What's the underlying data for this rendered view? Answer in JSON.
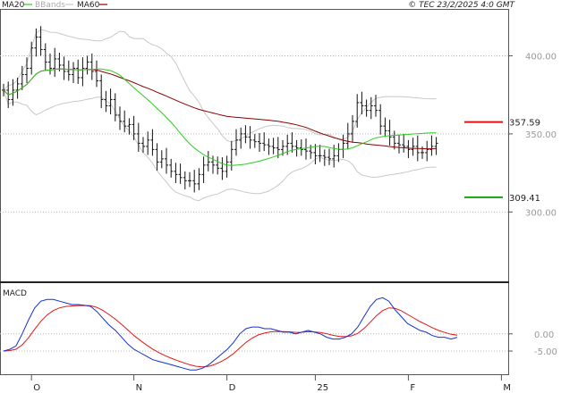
{
  "header": {
    "legend": [
      {
        "label": "MA20",
        "color": "#2ecc1f"
      },
      {
        "label": "BBands",
        "color": "#c8c8c8"
      },
      {
        "label": "MA60",
        "color": "#8b0000"
      }
    ],
    "copyright": "© TEC 23/2/2025 4:0 GMT"
  },
  "chart_data": [
    {
      "type": "line",
      "title": "",
      "ylim": [
        255,
        430
      ],
      "y_ticks": [
        {
          "label": "400.00",
          "value": 400
        },
        {
          "label": "350.00",
          "value": 350
        },
        {
          "label": "300.00",
          "value": 300
        }
      ],
      "x_ticks": [
        {
          "label": "O",
          "index": 6
        },
        {
          "label": "N",
          "index": 28
        },
        {
          "label": "D",
          "index": 48
        },
        {
          "label": "25",
          "index": 67
        },
        {
          "label": "F",
          "index": 87
        },
        {
          "label": "M",
          "index": 107
        }
      ],
      "levels": [
        {
          "label": "357.59",
          "value": 357.59,
          "color": "#e21010"
        },
        {
          "label": "309.41",
          "value": 309.41,
          "color": "#14a014"
        }
      ],
      "close": [
        378,
        372,
        378,
        382,
        388,
        392,
        405,
        412,
        404,
        396,
        392,
        398,
        394,
        390,
        388,
        392,
        386,
        392,
        396,
        390,
        384,
        372,
        368,
        372,
        362,
        358,
        355,
        356,
        350,
        344,
        342,
        346,
        340,
        332,
        334,
        330,
        326,
        324,
        322,
        320,
        320,
        318,
        324,
        330,
        332,
        330,
        328,
        326,
        332,
        340,
        346,
        350,
        348,
        346,
        345,
        344,
        343,
        342,
        341,
        340,
        342,
        344,
        342,
        341,
        340,
        339,
        338,
        336,
        336,
        335,
        334,
        336,
        340,
        344,
        350,
        358,
        370,
        368,
        365,
        368,
        365,
        355,
        352,
        348,
        344,
        343,
        342,
        340,
        342,
        338,
        338,
        340,
        342,
        344
      ]
    },
    {
      "type": "line",
      "title": "MACD",
      "ylim": [
        -1200,
        1500
      ],
      "y_ticks": [
        {
          "label": "0.00",
          "value": 0
        },
        {
          "label": "-5.00",
          "value": -500
        }
      ],
      "macd": [
        -500,
        -450,
        -350,
        0,
        400,
        750,
        950,
        1000,
        1000,
        950,
        900,
        850,
        850,
        830,
        800,
        650,
        450,
        250,
        100,
        -100,
        -300,
        -450,
        -550,
        -650,
        -750,
        -800,
        -850,
        -900,
        -950,
        -1000,
        -1050,
        -1050,
        -1000,
        -900,
        -750,
        -600,
        -450,
        -250,
        0,
        150,
        200,
        200,
        150,
        150,
        100,
        50,
        50,
        0,
        50,
        100,
        50,
        0,
        -100,
        -150,
        -150,
        -100,
        0,
        200,
        500,
        800,
        1000,
        1050,
        950,
        700,
        500,
        300,
        200,
        100,
        50,
        -50,
        -100,
        -100,
        -150,
        -100
      ]
    }
  ]
}
